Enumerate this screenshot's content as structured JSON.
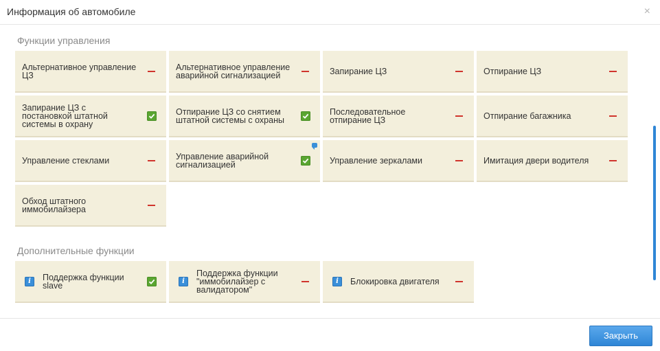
{
  "dialog": {
    "title": "Информация об автомобиле",
    "close_icon": "×",
    "close_button_label": "Закрыть"
  },
  "sections": {
    "control": {
      "title": "Функции управления",
      "items": [
        {
          "label": "Альтернативное управление ЦЗ",
          "enabled": false
        },
        {
          "label": "Альтернативное управление аварийной сигнализацией",
          "enabled": false
        },
        {
          "label": "Запирание ЦЗ",
          "enabled": false
        },
        {
          "label": "Отпирание ЦЗ",
          "enabled": false
        },
        {
          "label": "Запирание ЦЗ с постановкой штатной системы в охрану",
          "enabled": true
        },
        {
          "label": "Отпирание ЦЗ со снятием штатной системы с охраны",
          "enabled": true
        },
        {
          "label": "Последовательное отпирание ЦЗ",
          "enabled": false
        },
        {
          "label": "Отпирание багажника",
          "enabled": false
        },
        {
          "label": "Управление стеклами",
          "enabled": false
        },
        {
          "label": "Управление аварийной сигнализацией",
          "enabled": true,
          "has_note": true
        },
        {
          "label": "Управление зеркалами",
          "enabled": false
        },
        {
          "label": "Имитация двери водителя",
          "enabled": false
        },
        {
          "label": "Обход штатного иммобилайзера",
          "enabled": false
        }
      ]
    },
    "extra": {
      "title": "Дополнительные функции",
      "items": [
        {
          "label": "Поддержка функции slave",
          "enabled": true,
          "info_icon": "info-icon"
        },
        {
          "label": "Поддержка функции \"иммобилайзер с валидатором\"",
          "enabled": false,
          "info_icon": "info-icon"
        },
        {
          "label": "Блокировка двигателя",
          "enabled": false,
          "info_icon": "info-icon"
        }
      ]
    }
  },
  "colors": {
    "card_bg": "#f3efdc",
    "enabled": "#5aa531",
    "disabled": "#d0342c",
    "accent": "#2f86d6"
  }
}
